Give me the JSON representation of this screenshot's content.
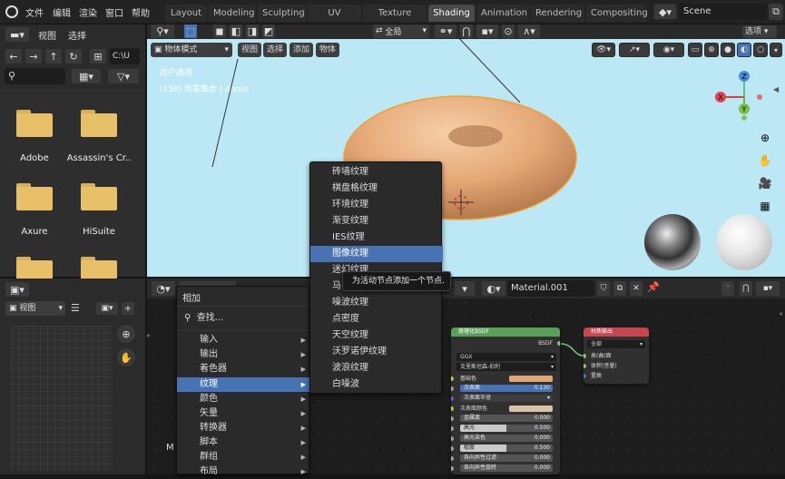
{
  "topbar": {
    "menus": [
      "文件",
      "编辑",
      "渲染",
      "窗口",
      "帮助"
    ],
    "tabs": [
      "Layout",
      "Modeling",
      "Sculpting",
      "UV Editing",
      "Texture Paint",
      "Shading",
      "Animation",
      "Rendering",
      "Compositing"
    ],
    "active_tab": "Shading",
    "scene_name": "Scene"
  },
  "file_browser": {
    "header": [
      "视图",
      "选择"
    ],
    "path": "C:\\U",
    "folders": [
      "Adobe",
      "Assassin's Cr..",
      "Axure",
      "HiSuite"
    ]
  },
  "viewport": {
    "mode": "物体模式",
    "menus": [
      "视图",
      "选择",
      "添加",
      "物体"
    ],
    "transform": "全局",
    "overlay_line1": "用户透视",
    "overlay_line2": "(138) 场景集合 | donut",
    "options": "选项",
    "axis_x": "X",
    "axis_y": "Y",
    "axis_z": "Z"
  },
  "image_editor": {
    "view_label": "视图"
  },
  "node_editor": {
    "material_name": "Material.001",
    "header_letter": "M"
  },
  "add_menu": {
    "title": "相加",
    "search": "查找...",
    "items": [
      "输入",
      "输出",
      "着色器",
      "纹理",
      "颜色",
      "矢量",
      "转换器",
      "脚本",
      "群组",
      "布局"
    ],
    "highlighted": "纹理"
  },
  "texture_submenu": {
    "items": [
      "砖墙纹理",
      "棋盘格纹理",
      "环境纹理",
      "渐变纹理",
      "IES纹理",
      "图像纹理",
      "迷幻纹理",
      "马氏纹理",
      "噪波纹理",
      "点密度",
      "天空纹理",
      "沃罗诺伊纹理",
      "波浪纹理",
      "白噪波"
    ],
    "highlighted": "图像纹理"
  },
  "tooltip": "为活动节点添加一个节点.",
  "principled_node": {
    "title": "原理化BSDF",
    "output": "BSDF",
    "distribution": "GGX",
    "subsurface_method": "克里斯坦森-伯利",
    "rows": [
      {
        "label": "基础色",
        "value": ""
      },
      {
        "label": "次表面",
        "value": "0.130"
      },
      {
        "label": "次表面半径",
        "value": ""
      },
      {
        "label": "次表面颜色",
        "value": ""
      },
      {
        "label": "金属度",
        "value": "0.000"
      },
      {
        "label": "高光",
        "value": "0.500"
      },
      {
        "label": "高光染色",
        "value": "0.000"
      },
      {
        "label": "糙度",
        "value": "0.500"
      },
      {
        "label": "各向异性过滤",
        "value": "0.000"
      },
      {
        "label": "各向异性旋转",
        "value": "0.000"
      }
    ]
  },
  "output_node": {
    "title": "材质输出",
    "target": "全部",
    "sockets": [
      "表(曲)面",
      "体积(音量)",
      "置换"
    ]
  },
  "colors": {
    "accent": "#4772b3",
    "viewport_bg": "#bce8f5",
    "node_green": "#5aa05a",
    "node_red": "#c84650"
  }
}
